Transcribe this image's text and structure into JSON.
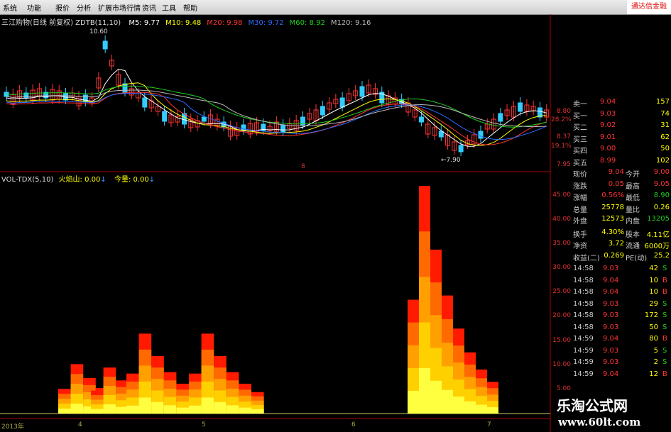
{
  "menu": [
    "系统",
    "功能",
    "报价",
    "分析",
    "扩展市场行情",
    "资讯",
    "工具",
    "帮助"
  ],
  "brand": "通达信金融",
  "title": {
    "name": "三江购物(日线 前复权) ZDTB(11,10)",
    "ma": [
      {
        "label": "M5: 9.77",
        "color": "#ffffff"
      },
      {
        "label": "M10: 9.48",
        "color": "#ffff00"
      },
      {
        "label": "M20: 9.98",
        "color": "#ff3030"
      },
      {
        "label": "M30: 9.72",
        "color": "#2f6bff"
      },
      {
        "label": "M60: 8.92",
        "color": "#20d020"
      },
      {
        "label": "M120: 9.16",
        "color": "#bbbbbb"
      }
    ],
    "high_label": "10.60",
    "low_label": "7.90"
  },
  "vol_title": {
    "name": "VOL-TDX(5,10)",
    "fire": "火焰山: 0.00",
    "qty": "今量: 0.00"
  },
  "price_axis": [
    "8.80",
    "28.2%",
    "8.37",
    "19.1%",
    "7.95"
  ],
  "vol_axis": [
    "45.00",
    "40.00",
    "35.00",
    "30.00",
    "25.00",
    "20.00",
    "15.00",
    "10.00",
    "5.00"
  ],
  "dates": [
    "2013年",
    "4",
    "5",
    "6",
    "7"
  ],
  "mid_marker": "8",
  "order_book": [
    {
      "label": "卖一",
      "price": "9.04",
      "vol": "157"
    },
    {
      "label": "买一",
      "price": "9.03",
      "vol": "74"
    },
    {
      "label": "买二",
      "price": "9.02",
      "vol": "31"
    },
    {
      "label": "买三",
      "price": "9.01",
      "vol": "62"
    },
    {
      "label": "买四",
      "price": "9.00",
      "vol": "50"
    },
    {
      "label": "买五",
      "price": "8.99",
      "vol": "102"
    }
  ],
  "quote": [
    {
      "l1": "现价",
      "v1": "9.04",
      "l2": "今开",
      "v2": "9.00"
    },
    {
      "l1": "涨跌",
      "v1": "0.05",
      "l2": "最高",
      "v2": "9.05"
    },
    {
      "l1": "涨幅",
      "v1": "0.56%",
      "l2": "最低",
      "v2": "8.90"
    },
    {
      "l1": "总量",
      "v1": "25778",
      "l2": "量比",
      "v2": "0.26"
    },
    {
      "l1": "外盘",
      "v1": "12573",
      "l2": "内盘",
      "v2": "13205"
    }
  ],
  "stats": [
    {
      "l1": "换手",
      "v1": "4.30%",
      "l2": "股本",
      "v2": "4.11亿"
    },
    {
      "l1": "净资",
      "v1": "3.72",
      "l2": "流通",
      "v2": "6000万"
    },
    {
      "l1": "收益(二)",
      "v1": "0.269",
      "l2": "PE(动)",
      "v2": "25.2"
    }
  ],
  "ticks": [
    {
      "time": "14:58",
      "price": "9.03",
      "vol": "42",
      "side": "S"
    },
    {
      "time": "14:58",
      "price": "9.04",
      "vol": "10",
      "side": "B"
    },
    {
      "time": "14:58",
      "price": "9.04",
      "vol": "10",
      "side": "B"
    },
    {
      "time": "14:58",
      "price": "9.03",
      "vol": "29",
      "side": "S"
    },
    {
      "time": "14:58",
      "price": "9.03",
      "vol": "172",
      "side": "S"
    },
    {
      "time": "14:58",
      "price": "9.03",
      "vol": "50",
      "side": "S"
    },
    {
      "time": "14:59",
      "price": "9.04",
      "vol": "80",
      "side": "B"
    },
    {
      "time": "14:59",
      "price": "9.03",
      "vol": "5",
      "side": "S"
    },
    {
      "time": "14:59",
      "price": "9.03",
      "vol": "2",
      "side": "S"
    },
    {
      "time": "14:59",
      "price": "9.04",
      "vol": "12",
      "side": "B"
    }
  ],
  "watermark": {
    "cn": "乐淘公式网",
    "url": "www.60lt.com"
  },
  "volume_bursts": [
    {
      "date": "2013-04",
      "peak": 10.2
    },
    {
      "date": "2013-04",
      "peak": 9.5
    },
    {
      "date": "2013-04",
      "peak": 16.5
    },
    {
      "date": "2013-05",
      "peak": 16.5
    },
    {
      "date": "2013-06",
      "peak": 47.0
    }
  ]
}
